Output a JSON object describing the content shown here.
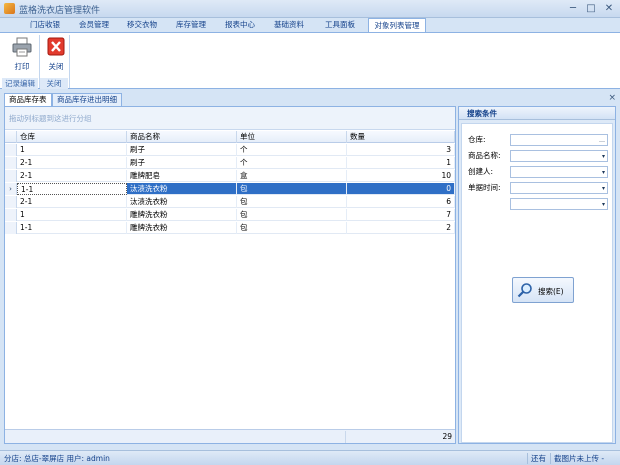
{
  "window": {
    "title": "蓝格洗衣店管理软件",
    "minimize": "─",
    "maximize": "□",
    "close": "✕"
  },
  "ribbon_tabs": [
    "门店收银",
    "会员管理",
    "移交衣物",
    "库存管理",
    "报表中心",
    "基础资料",
    "工具面板",
    "对象列表管理"
  ],
  "ribbon": {
    "print_label": "打印",
    "close_label": "关闭",
    "group_record_edit": "记录编辑",
    "group_close": "关闭"
  },
  "doc_tabs": [
    "商品库存表",
    "商品库存进出明细"
  ],
  "doc_close": "×",
  "grid": {
    "group_hint": "拖动列标题到这进行分组",
    "columns": [
      "仓库",
      "商品名称",
      "单位",
      "数量"
    ],
    "rows": [
      [
        "1",
        "刷子",
        "个",
        "3"
      ],
      [
        "2-1",
        "刷子",
        "个",
        "1"
      ],
      [
        "2-1",
        "雕牌肥皂",
        "盒",
        "10"
      ],
      [
        "1-1",
        "汰渍洗衣粉",
        "包",
        "0"
      ],
      [
        "2-1",
        "汰渍洗衣粉",
        "包",
        "6"
      ],
      [
        "1",
        "雕牌洗衣粉",
        "包",
        "7"
      ],
      [
        "1-1",
        "雕牌洗衣粉",
        "包",
        "2"
      ]
    ],
    "selected_row": 3,
    "total": "29"
  },
  "search_panel": {
    "title": "搜索条件",
    "fields": [
      {
        "label": "仓库:",
        "control": "…"
      },
      {
        "label": "商品名称:",
        "control": "▾"
      },
      {
        "label": "创建人:",
        "control": "▾"
      },
      {
        "label": "单据时间:",
        "control": "▾"
      },
      {
        "label": "",
        "control": "▾"
      }
    ],
    "search_button": "搜索(E)"
  },
  "status": {
    "left": "分店: 总店-翠屏店  用户: admin",
    "mid": "还有",
    "right": "截图片未上传 -"
  }
}
